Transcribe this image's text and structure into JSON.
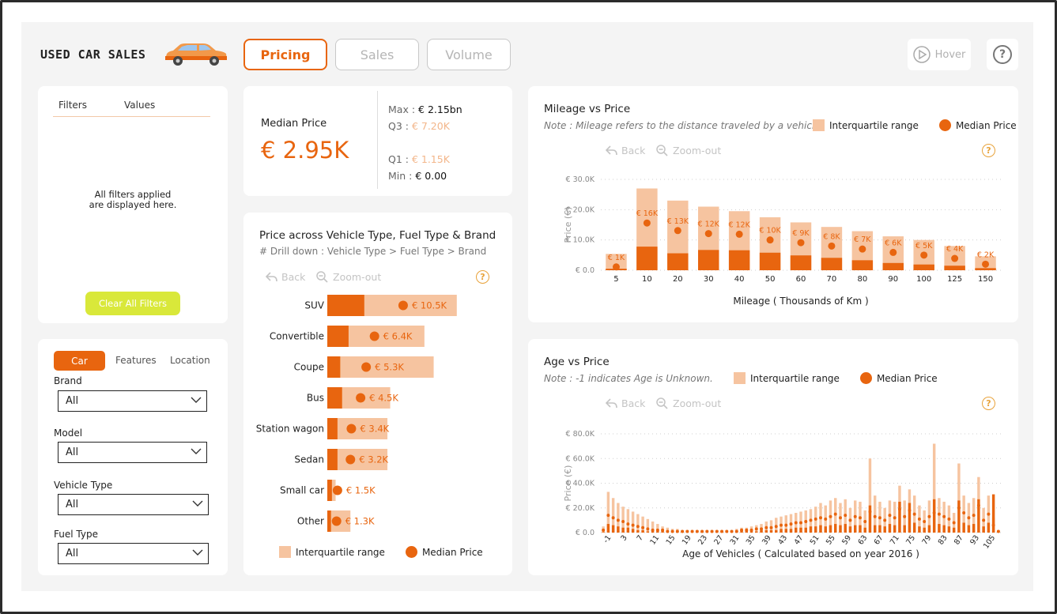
{
  "header": {
    "title": "USED CAR SALES",
    "nav": [
      "Pricing",
      "Sales",
      "Volume"
    ],
    "active_nav": "Pricing",
    "hover_label": "Hover",
    "help_glyph": "?"
  },
  "filters_panel": {
    "col_filters": "Filters",
    "col_values": "Values",
    "empty_line1": "All filters applied",
    "empty_line2": "are displayed here.",
    "clear_button": "Clear All Filters"
  },
  "slicer_panel": {
    "tabs": [
      "Car",
      "Features",
      "Location"
    ],
    "active_tab": "Car",
    "fields": [
      {
        "label": "Brand",
        "value": "All"
      },
      {
        "label": "Model",
        "value": "All"
      },
      {
        "label": "Vehicle Type",
        "value": "All"
      },
      {
        "label": "Fuel Type",
        "value": "All"
      }
    ]
  },
  "kpi": {
    "label": "Median Price",
    "value": "€ 2.95K",
    "max_label": "Max : ",
    "max_value": "€ 2.15bn",
    "q3_label": "Q3 : ",
    "q3_value": "€ 7.20K",
    "q1_label": "Q1 : ",
    "q1_value": "€ 1.15K",
    "min_label": "Min : ",
    "min_value": "€ 0.00"
  },
  "controls": {
    "back": "Back",
    "zoom_out": "Zoom-out"
  },
  "legend": {
    "iqr": "Interquartile range",
    "median": "Median Price"
  },
  "colors": {
    "accent": "#e8650f",
    "iqr": "#f6c4a0",
    "lower_quartile": "#e8650f",
    "clear_btn": "#d9e83a",
    "help": "#e8a23a"
  },
  "chart_data": [
    {
      "type": "bar",
      "id": "vehicle_type",
      "title": "Price across Vehicle Type, Fuel Type & Brand",
      "subtitle": "# Drill down : Vehicle Type > Fuel Type > Brand",
      "orientation": "horizontal",
      "categories": [
        "SUV",
        "Convertible",
        "Coupe",
        "Bus",
        "Station wagon",
        "Sedan",
        "Small car",
        "Other"
      ],
      "q1": [
        4.0,
        2.3,
        1.4,
        1.6,
        1.1,
        1.1,
        0.5,
        0.4
      ],
      "q3": [
        14.0,
        10.5,
        11.5,
        6.8,
        6.5,
        6.5,
        0.9,
        2.5
      ],
      "median": [
        8.2,
        5.1,
        4.2,
        3.6,
        2.6,
        2.5,
        1.1,
        1.0
      ],
      "median_labels": [
        "€ 10.5K",
        "€ 6.4K",
        "€ 5.3K",
        "€ 4.5K",
        "€ 3.4K",
        "€ 3.2K",
        "€ 1.5K",
        "€ 1.3K"
      ]
    },
    {
      "type": "bar",
      "id": "mileage",
      "title": "Mileage vs Price",
      "note": "Note : Mileage refers to the distance traveled by a vehicle",
      "xlabel": "Mileage ( Thousands of Km )",
      "ylabel": "Price (€)",
      "yticks": [
        "€ 0.0",
        "€ 10.0K",
        "€ 20.0K",
        "€ 30.0K"
      ],
      "ylim": [
        0,
        30
      ],
      "categories": [
        "5",
        "10",
        "20",
        "30",
        "40",
        "50",
        "60",
        "70",
        "80",
        "90",
        "100",
        "125",
        "150"
      ],
      "q1": [
        0.5,
        7.8,
        5.6,
        6.7,
        6.6,
        5.8,
        4.9,
        4.1,
        3.3,
        2.4,
        1.9,
        1.5,
        0.7
      ],
      "q3": [
        5.4,
        27.0,
        23.0,
        21.0,
        19.5,
        17.5,
        15.8,
        14.3,
        12.9,
        11.2,
        10.0,
        8.0,
        4.6
      ],
      "median": [
        1.1,
        15.6,
        13.1,
        12.1,
        11.9,
        10.0,
        9.1,
        8.0,
        7.0,
        5.9,
        5.0,
        3.9,
        2.0
      ],
      "median_labels": [
        "€ 1K",
        "€ 16K",
        "€ 13K",
        "€ 12K",
        "€ 12K",
        "€ 10K",
        "€ 9K",
        "€ 8K",
        "€ 7K",
        "€ 6K",
        "€ 5K",
        "€ 4K",
        "€ 2K"
      ]
    },
    {
      "type": "bar",
      "id": "age",
      "title": "Age vs Price",
      "note": "Note : -1 indicates Age is Unknown.",
      "xlabel": "Age of Vehicles ( Calculated based on year 2016 )",
      "ylabel": "Price (€)",
      "yticks": [
        "€ 0.0",
        "€ 20.0K",
        "€ 40.0K",
        "€ 60.0K",
        "€ 80.0K"
      ],
      "ylim": [
        0,
        80
      ],
      "xticks": [
        "-1",
        "3",
        "7",
        "11",
        "15",
        "19",
        "23",
        "27",
        "31",
        "35",
        "39",
        "43",
        "47",
        "51",
        "55",
        "59",
        "63",
        "67",
        "71",
        "75",
        "79",
        "83",
        "87",
        "93",
        "105"
      ],
      "q3": [
        5,
        33,
        28,
        24,
        21,
        19,
        17,
        15,
        13,
        11,
        9,
        7,
        5,
        4,
        3,
        3,
        2,
        2,
        2,
        2,
        2,
        2,
        2,
        2,
        2,
        2,
        2,
        3,
        4,
        4,
        5,
        6,
        7,
        9,
        10,
        12,
        13,
        14,
        15,
        16,
        17,
        18,
        19,
        21,
        24,
        22,
        26,
        28,
        24,
        27,
        20,
        26,
        25,
        18,
        60,
        30,
        25,
        20,
        26,
        25,
        38,
        26,
        35,
        30,
        22,
        18,
        26,
        72,
        28,
        25,
        22,
        16,
        56,
        30,
        24,
        28,
        45,
        20,
        30,
        12,
        2
      ],
      "median": [
        2,
        14,
        12,
        10,
        9,
        7,
        6,
        5,
        4,
        3,
        2,
        2,
        2,
        1,
        1,
        1,
        1,
        1,
        1,
        1,
        1,
        1,
        1,
        1,
        1,
        1,
        1,
        1,
        2,
        2,
        2,
        3,
        3,
        4,
        4,
        5,
        6,
        6,
        7,
        8,
        8,
        9,
        10,
        11,
        12,
        11,
        13,
        15,
        12,
        14,
        10,
        13,
        12,
        9,
        17,
        13,
        12,
        10,
        14,
        12,
        19,
        13,
        18,
        15,
        11,
        9,
        13,
        16,
        15,
        13,
        11,
        8,
        20,
        16,
        12,
        14,
        22,
        10,
        15,
        6,
        1
      ],
      "q1": [
        0.5,
        7,
        6,
        5,
        4,
        4,
        3,
        2,
        2,
        1,
        1,
        1,
        1,
        0.5,
        0.5,
        0.5,
        0.5,
        0.5,
        0.5,
        0.5,
        0.5,
        0.5,
        0.5,
        0.5,
        0.5,
        0.5,
        0.5,
        0.5,
        1,
        1,
        1,
        1,
        2,
        2,
        2,
        2,
        3,
        3,
        3,
        4,
        4,
        4,
        5,
        5,
        6,
        5,
        6,
        7,
        6,
        7,
        5,
        6,
        6,
        4,
        22,
        6,
        6,
        5,
        7,
        6,
        25,
        6,
        24,
        8,
        5,
        4,
        6,
        27,
        7,
        6,
        5,
        4,
        26,
        8,
        6,
        7,
        27,
        5,
        8,
        31,
        0.5
      ]
    }
  ]
}
